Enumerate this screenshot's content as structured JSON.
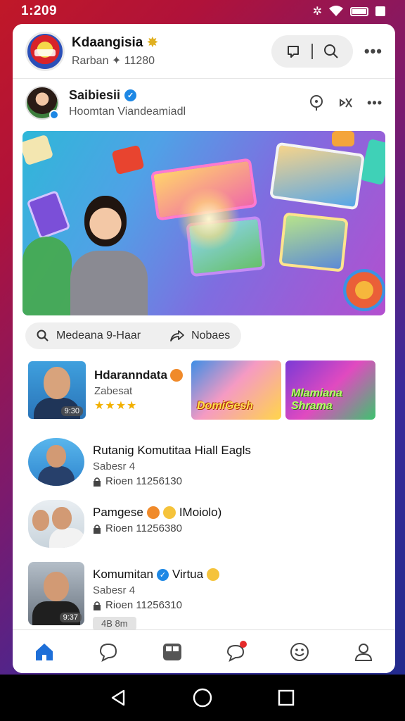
{
  "status_bar": {
    "time": "1:209"
  },
  "header": {
    "title": "Kdaangisia",
    "subtitle": "Rarban ✦ 11280"
  },
  "post": {
    "author": "Saibiesii",
    "subtitle": "Hoomtan Viandeamiadl"
  },
  "share": {
    "left_label": "Medeana 9-Haar",
    "right_label": "Nobaes"
  },
  "recommended": {
    "title": "Hdaranndata",
    "subtitle": "Zabesat",
    "stars": "★★★★",
    "duration": "9:30",
    "card1_text": "DomiGesh",
    "card2_text": "Mlamiana Shrama"
  },
  "list": [
    {
      "title": "Rutanig Komutitaa Hiall Eagls",
      "sub": "Sabesr 4",
      "meta": "Rioen 11256130",
      "tag": ""
    },
    {
      "title": "Pamgese",
      "title_suffix": "IMoiolo)",
      "sub": "",
      "meta": "Rioen 11256380",
      "tag": ""
    },
    {
      "title": "Komumitan",
      "title_suffix": "Virtua",
      "sub": "Sabesr 4",
      "meta": "Rioen 11256310",
      "tag": "4B 8m",
      "duration": "9:37"
    }
  ],
  "colors": {
    "accent": "#1e88e5",
    "nav_active": "#1e6fd8",
    "notification": "#e52b2b"
  },
  "icons": {
    "header_pill": [
      "chat-bubble-icon",
      "search-icon"
    ],
    "post_actions": [
      "pin-icon",
      "mute-icon",
      "more-icon"
    ],
    "bottom_nav": [
      "home-icon",
      "chat-icon",
      "feed-icon",
      "notification-chat-icon",
      "emoji-icon",
      "profile-icon"
    ],
    "system_nav": [
      "back-icon",
      "home-circle-icon",
      "recents-icon"
    ]
  }
}
